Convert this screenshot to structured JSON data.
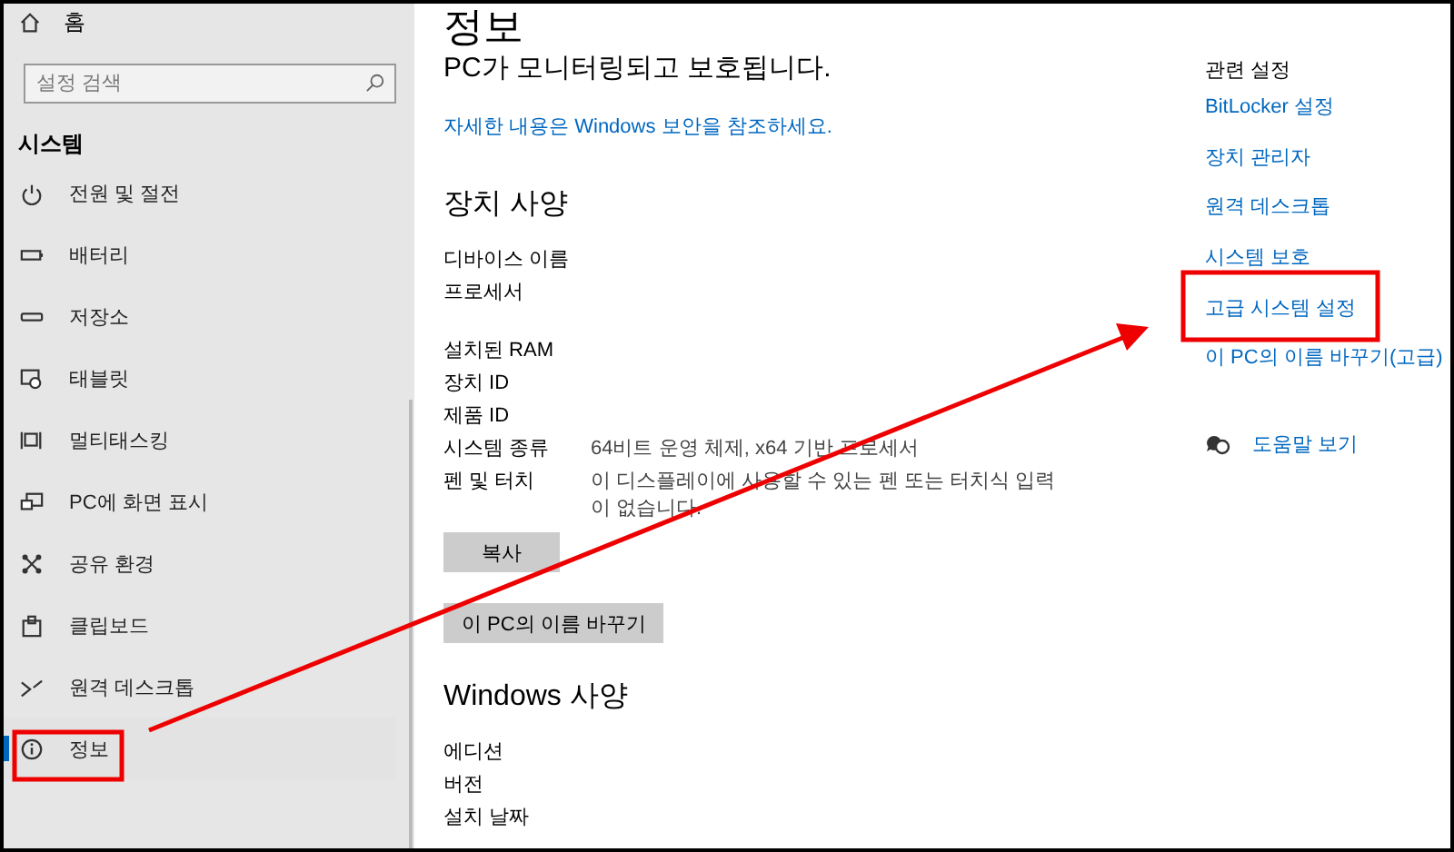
{
  "sidebar": {
    "home": "홈",
    "search": {
      "placeholder": "설정 검색"
    },
    "section": "시스템",
    "items": [
      {
        "label": "전원 및 절전",
        "selected": false
      },
      {
        "label": "배터리",
        "selected": false
      },
      {
        "label": "저장소",
        "selected": false
      },
      {
        "label": "태블릿",
        "selected": false
      },
      {
        "label": "멀티태스킹",
        "selected": false
      },
      {
        "label": "PC에 화면 표시",
        "selected": false
      },
      {
        "label": "공유 환경",
        "selected": false
      },
      {
        "label": "클립보드",
        "selected": false
      },
      {
        "label": "원격 데스크톱",
        "selected": false
      },
      {
        "label": "정보",
        "selected": true
      }
    ]
  },
  "main": {
    "title": "정보",
    "status": "PC가 모니터링되고 보호됩니다.",
    "security_link": "자세한 내용은 Windows 보안을 참조하세요.",
    "device_specs": {
      "heading": "장치 사양",
      "groups": [
        [
          {
            "label": "디바이스 이름"
          },
          {
            "label": "프로세서"
          }
        ],
        [
          {
            "label": "설치된 RAM"
          },
          {
            "label": "장치 ID"
          },
          {
            "label": "제품 ID"
          },
          {
            "label": "시스템 종류",
            "value": "64비트 운영 체제, x64 기반 프로세서"
          },
          {
            "label": "펜 및 터치",
            "value": "이 디스플레이에 사용할 수 있는 펜 또는 터치식 입력이 없습니다."
          }
        ]
      ]
    },
    "buttons": [
      "복사",
      "이 PC의 이름 바꾸기"
    ],
    "windows_specs": {
      "heading": "Windows 사양",
      "rows": [
        {
          "label": "에디션"
        },
        {
          "label": "버전"
        },
        {
          "label": "설치 날짜"
        }
      ]
    }
  },
  "related": {
    "heading": "관련 설정",
    "links": [
      "BitLocker 설정",
      "장치 관리자",
      "원격 데스크톱",
      "시스템 보호",
      "고급 시스템 설정",
      "이 PC의 이름 바꾸기(고급)"
    ],
    "help": "도움말 보기"
  }
}
